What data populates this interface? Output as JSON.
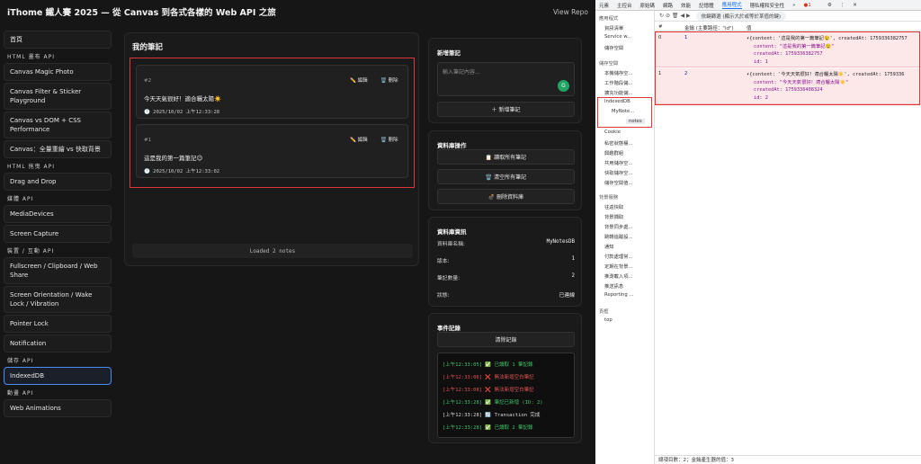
{
  "app": {
    "title": "iThome 鐵人賽 2025 — 從 Canvas 到各式各樣的 Web API 之旅",
    "view_repo": "View Repo"
  },
  "sidebar": {
    "home": "首頁",
    "sections": [
      {
        "title": "HTML 畫布 API",
        "items": [
          "Canvas Magic Photo",
          "Canvas Filter & Sticker Playground",
          "Canvas vs DOM + CSS Performance",
          "Canvas：全量重繪 vs 快取背景"
        ]
      },
      {
        "title": "HTML 拖曳 API",
        "items": [
          "Drag and Drop"
        ]
      },
      {
        "title": "媒體 API",
        "items": [
          "MediaDevices",
          "Screen Capture"
        ]
      },
      {
        "title": "裝置 / 互動 API",
        "items": [
          "Fullscreen / Clipboard / Web Share",
          "Screen Orientation / Wake Lock / Vibration",
          "Pointer Lock",
          "Notification"
        ]
      },
      {
        "title": "儲存 API",
        "items": [
          "IndexedDB"
        ]
      },
      {
        "title": "動畫 API",
        "items": [
          "Web Animations"
        ]
      }
    ],
    "active": "IndexedDB"
  },
  "notes_panel": {
    "title": "我的筆記",
    "edit_label": "✏️ 編輯",
    "delete_label": "🗑️ 刪除",
    "notes": [
      {
        "id": "#2",
        "text": "今天天氣很好！適合曬太陽☀️",
        "time": "🕐 2025/10/02 上午12:33:28"
      },
      {
        "id": "#1",
        "text": "這是我的第一篇筆記😉",
        "time": "🕐 2025/10/02 上午12:33:02"
      }
    ],
    "loaded": "Loaded 2 notes"
  },
  "add_note": {
    "title": "新增筆記",
    "placeholder": "輸入筆記內容...",
    "button": "＋ 新增筆記"
  },
  "db_ops": {
    "title": "資料庫操作",
    "read_all": "📋 讀取所有筆記",
    "clear_all": "🗑️ 清空所有筆記",
    "delete_db": "💣 刪除資料庫"
  },
  "db_info": {
    "title": "資料庫資訊",
    "rows": [
      {
        "label": "資料庫名稱:",
        "value": "MyNotesDB"
      },
      {
        "label": "版本:",
        "value": "1"
      },
      {
        "label": "筆記數量:",
        "value": "2"
      },
      {
        "label": "狀態:",
        "value": "已連線"
      }
    ]
  },
  "event_log": {
    "title": "事件記錄",
    "clear": "清除記錄",
    "logs": [
      {
        "text": "[上午12:33:05] ✅ 已讀取 1 筆記錄",
        "kind": "g"
      },
      {
        "text": "[上午12:33:06] ❌ 無法新增空白筆記",
        "kind": "r"
      },
      {
        "text": "[上午12:33:08] ❌ 無法新增空白筆記",
        "kind": "r"
      },
      {
        "text": "[上午12:33:28] ✅ 筆記已新增 (ID: 2)",
        "kind": "g"
      },
      {
        "text": "[上午12:33:28] 🔄 Transaction 完成",
        "kind": "w"
      },
      {
        "text": "[上午12:33:28] ✅ 已讀取 2 筆記錄",
        "kind": "g"
      }
    ]
  },
  "devtools": {
    "tabs": [
      "元素",
      "主控台",
      "原始碼",
      "網路",
      "效能",
      "記憶體",
      "應用程式",
      "隱私權和安全性",
      "»"
    ],
    "active_tab": "應用程式",
    "error_count": "1",
    "filter_placeholder": "依鍵篩選 (顯示大於或等於某值的鍵)",
    "tree": {
      "app_section": "應用程式",
      "app_items": [
        "資訊清單",
        "Service w...",
        "儲存空間"
      ],
      "storage_section": "儲存空間",
      "storage_items": [
        "本機儲存空...",
        "工作階段儲...",
        "擴充功能儲..."
      ],
      "idb": "IndexedDB",
      "idb_db": "MyNote...",
      "idb_store": "notes",
      "storage_items2": [
        "Cookie",
        "私密狀態權...",
        "興趣群組",
        "共用儲存空...",
        "快取儲存空...",
        "儲存空間值..."
      ],
      "bg_section": "背景服務",
      "bg_items": [
        "往返快取",
        "背景擷取",
        "背景同步處...",
        "跳轉追蹤設...",
        "通知",
        "付款處理常...",
        "定期在背景...",
        "推測載入項...",
        "推送訊息",
        "Reporting ..."
      ],
      "frames_section": "頁框",
      "frame_top": "top"
    },
    "table": {
      "col_index": "#",
      "col_key": "金鑰 (主要路徑：\"id\")",
      "col_value": "值",
      "rows": [
        {
          "index": "0",
          "key": "1",
          "summary": "▾{content: '這是我的第一篇筆記😉', createdAt: 1759336382757",
          "content": "content: \"這是我的第一篇筆記😉\"",
          "createdAt": "createdAt: 1759336382757",
          "id": "id: 1"
        },
        {
          "index": "1",
          "key": "2",
          "summary": "▾{content: '今天天氣很好！適合曬太陽☀️', createdAt: 1759336",
          "content": "content: \"今天天氣很好！適合曬太陽☀️\"",
          "createdAt": "createdAt: 1759336408324",
          "id": "id: 2"
        }
      ]
    },
    "status": "總項目數：2；金鑰產生器的值：3"
  }
}
